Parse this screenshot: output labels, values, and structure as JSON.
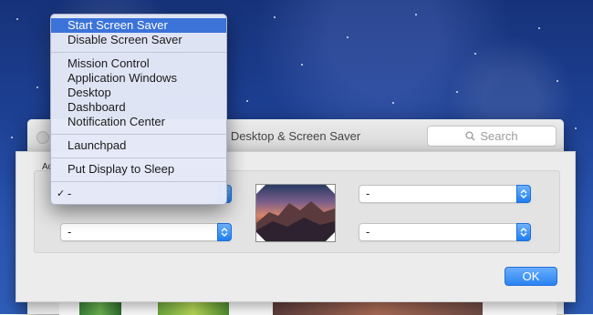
{
  "window": {
    "title": "Desktop & Screen Saver"
  },
  "search": {
    "placeholder": "Search"
  },
  "sheet": {
    "label_partial": "Ac"
  },
  "menu": {
    "items": [
      "Start Screen Saver",
      "Disable Screen Saver",
      "Mission Control",
      "Application Windows",
      "Desktop",
      "Dashboard",
      "Notification Center",
      "Launchpad",
      "Put Display to Sleep",
      "-"
    ],
    "selected": "Start Screen Saver",
    "checked": "-"
  },
  "corners": {
    "top_left": "-",
    "top_right": "-",
    "bottom_left": "-",
    "bottom_right": "-"
  },
  "buttons": {
    "ok": "OK"
  },
  "colors": {
    "accent": "#2a83f2",
    "menu_highlight": "#3b73d9"
  },
  "icons": {
    "search": "search-icon",
    "stepper": "stepper-icon",
    "check": "checkmark-icon"
  }
}
